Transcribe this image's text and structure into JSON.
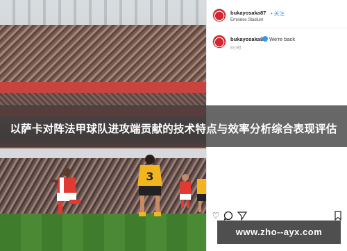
{
  "overlay": {
    "title": "以萨卡对阵法甲球队进攻端贡献的技术特点与效率分析综合表现评估",
    "watermark": "www.zho--ayx.com"
  },
  "post": {
    "username": "bukayosaka87",
    "follow_label": "• 关注",
    "location": "Emirates Stadium",
    "comment": {
      "username": "bukayosaka87",
      "text": "We're back",
      "time": "8小时"
    }
  },
  "photo": {
    "players": [
      {
        "name": "arsenal-player",
        "color": "#e03a33"
      },
      {
        "name": "wolves-player",
        "number": "3",
        "color": "#f2b51f"
      }
    ]
  },
  "colors": {
    "accent": "#3897f0",
    "arsenal_red": "#e03a33",
    "wolves_gold": "#f2b51f"
  },
  "icons": [
    "heart-icon",
    "comment-icon",
    "share-icon",
    "bookmark-icon",
    "verified-badge-icon"
  ]
}
